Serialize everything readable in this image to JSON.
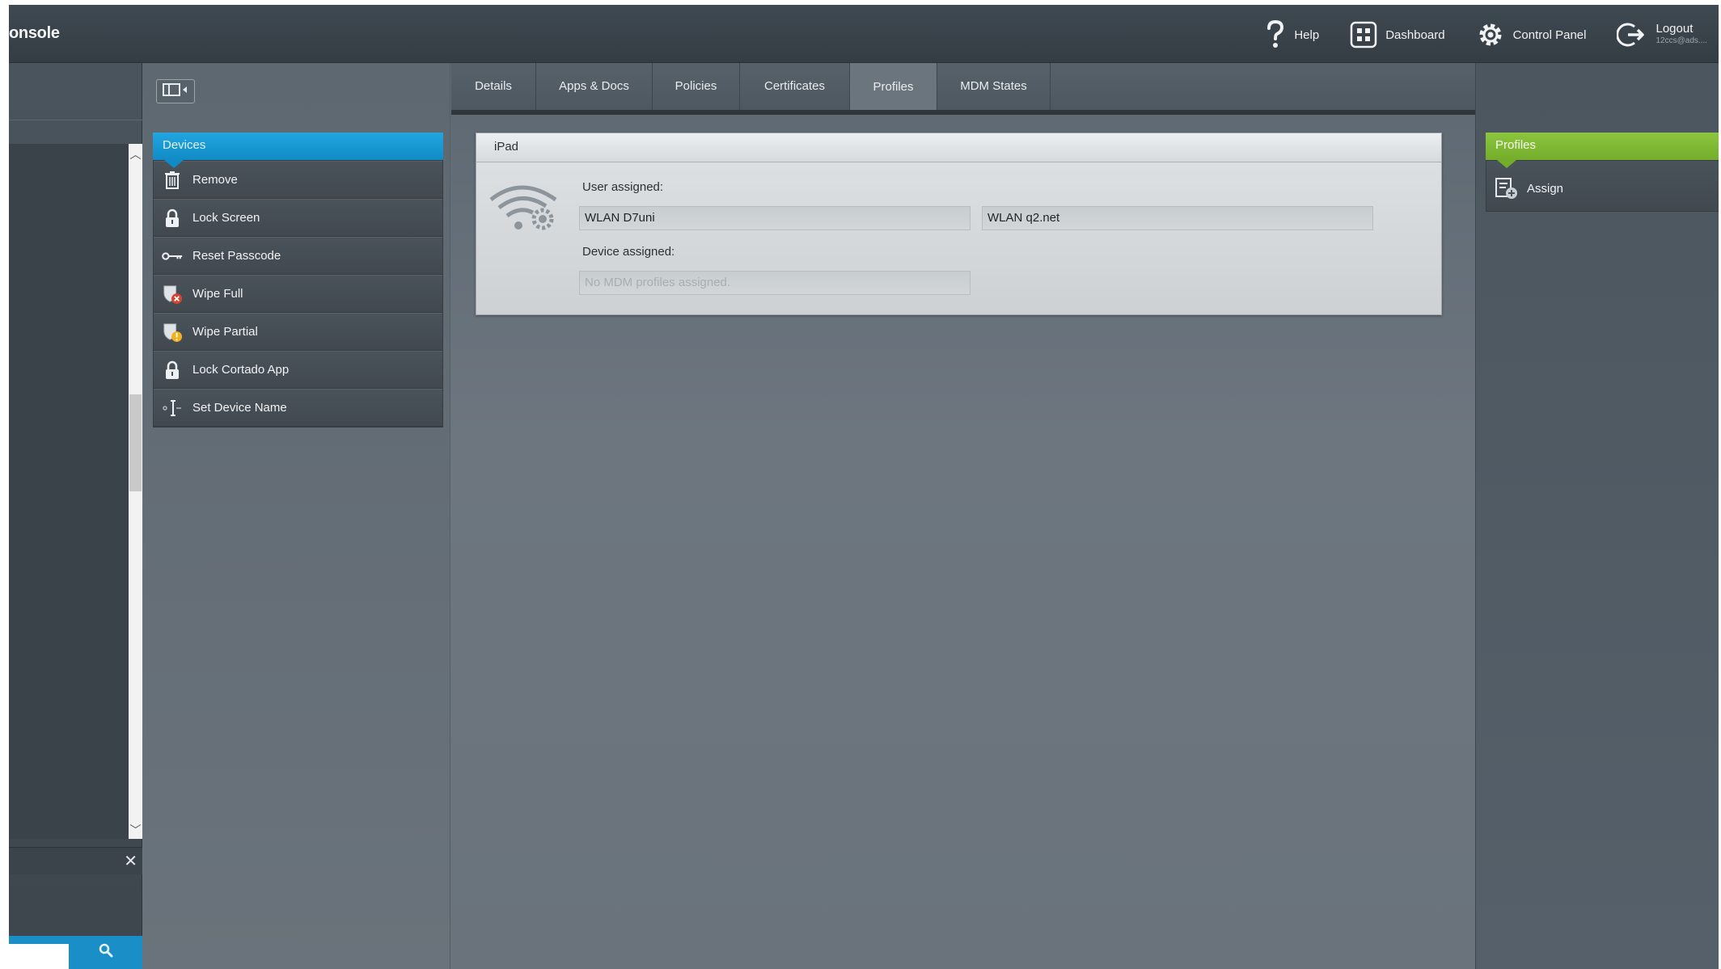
{
  "header": {
    "app_title": "onsole",
    "help_label": "Help",
    "dashboard_label": "Dashboard",
    "control_panel_label": "Control Panel",
    "logout_label": "Logout",
    "logout_user": "12ccs@ads...."
  },
  "actions": {
    "header": "Devices",
    "items": [
      {
        "label": "Remove",
        "icon": "trash-icon"
      },
      {
        "label": "Lock Screen",
        "icon": "lock-icon"
      },
      {
        "label": "Reset Passcode",
        "icon": "key-icon"
      },
      {
        "label": "Wipe Full",
        "icon": "shield-x-icon"
      },
      {
        "label": "Wipe Partial",
        "icon": "shield-warning-icon"
      },
      {
        "label": "Lock Cortado App",
        "icon": "lock-icon"
      },
      {
        "label": "Set Device Name",
        "icon": "text-cursor-icon"
      }
    ]
  },
  "tabs": [
    "Details",
    "Apps & Docs",
    "Policies",
    "Certificates",
    "Profiles",
    "MDM States"
  ],
  "active_tab": "Profiles",
  "device": {
    "title": "iPad",
    "user_assigned_label": "User assigned:",
    "user_profiles": [
      "WLAN D7uni",
      "WLAN q2.net"
    ],
    "device_assigned_label": "Device assigned:",
    "device_profiles_empty": "No MDM profiles assigned."
  },
  "profiles_panel": {
    "header": "Profiles",
    "assign_label": "Assign"
  },
  "search": {
    "placeholder": ""
  },
  "colors": {
    "devices_header": "#118bc5",
    "profiles_header": "#8cc63f",
    "search_bar": "#1a8fc7"
  }
}
